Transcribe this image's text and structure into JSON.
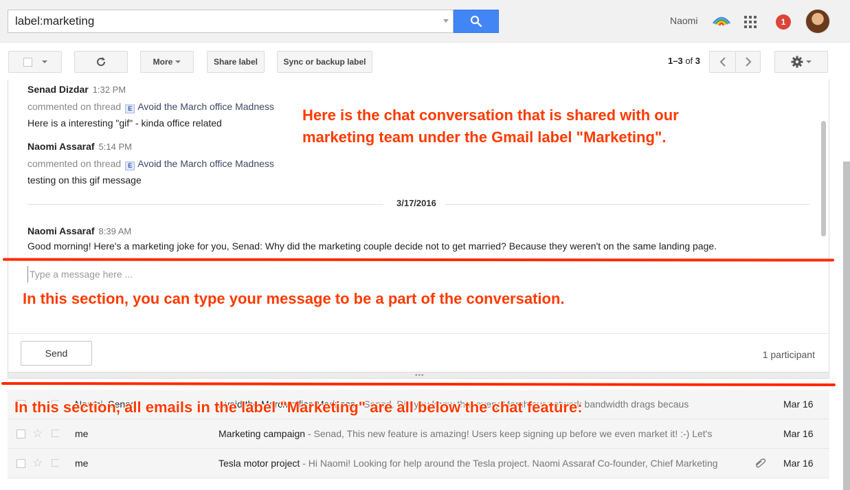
{
  "search": {
    "value": "label:marketing"
  },
  "header": {
    "user_name": "Naomi",
    "notification_count": "1"
  },
  "toolbar": {
    "more_label": "More",
    "share_label": "Share label",
    "sync_label": "Sync or backup label",
    "pager_range": "1–3",
    "pager_of": "of",
    "pager_total": "3"
  },
  "chat": {
    "messages": [
      {
        "sender": "Senad Dizdar",
        "time": "1:32 PM",
        "action": "commented on thread",
        "thread_title": "Avoid the March office Madness",
        "text": "Here is a interesting \"gif\" - kinda office related"
      },
      {
        "sender": "Naomi Assaraf",
        "time": "5:14 PM",
        "action": "commented on thread",
        "thread_title": "Avoid the March office Madness",
        "text": "testing on this gif message"
      },
      {
        "sender": "Naomi Assaraf",
        "time": "8:39 AM",
        "text": "Good morning! Here's a marketing joke for you, Senad: Why did the marketing couple decide not to get married? Because they weren't on the same landing page."
      }
    ],
    "date_separator": "3/17/2016",
    "compose_placeholder": "Type a message here ...",
    "send_label": "Send",
    "participants": "1 participant"
  },
  "annotations": {
    "top_line1": "Here is the chat conversation that is shared with our",
    "top_line2": "marketing team under the Gmail label \"Marketing\".",
    "middle": "In this section, you can type your message to be a part of the conversation.",
    "bottom": "In this section, all emails in the label \"Marketing\" are all below the chat feature:",
    "color": "#ff3a00"
  },
  "emails": [
    {
      "sender": "Naomi, Senad",
      "subject": "Avoid the March office Madness",
      "snippet": "Senad, Did you know that every March our network bandwidth drags becaus",
      "date": "Mar 16",
      "attachment": false
    },
    {
      "sender": "me",
      "subject": "Marketing campaign",
      "snippet": "Senad, This new feature is amazing! Users keep signing up before we even market it! :-) Let's",
      "date": "Mar 16",
      "attachment": false
    },
    {
      "sender": "me",
      "subject": "Tesla motor project",
      "snippet": "Hi Naomi! Looking for help around the Tesla project. Naomi Assaraf Co-founder, Chief Marketing",
      "date": "Mar 16",
      "attachment": true
    }
  ],
  "colors": {
    "search_button": "#4285f4",
    "notification": "#db4437"
  }
}
